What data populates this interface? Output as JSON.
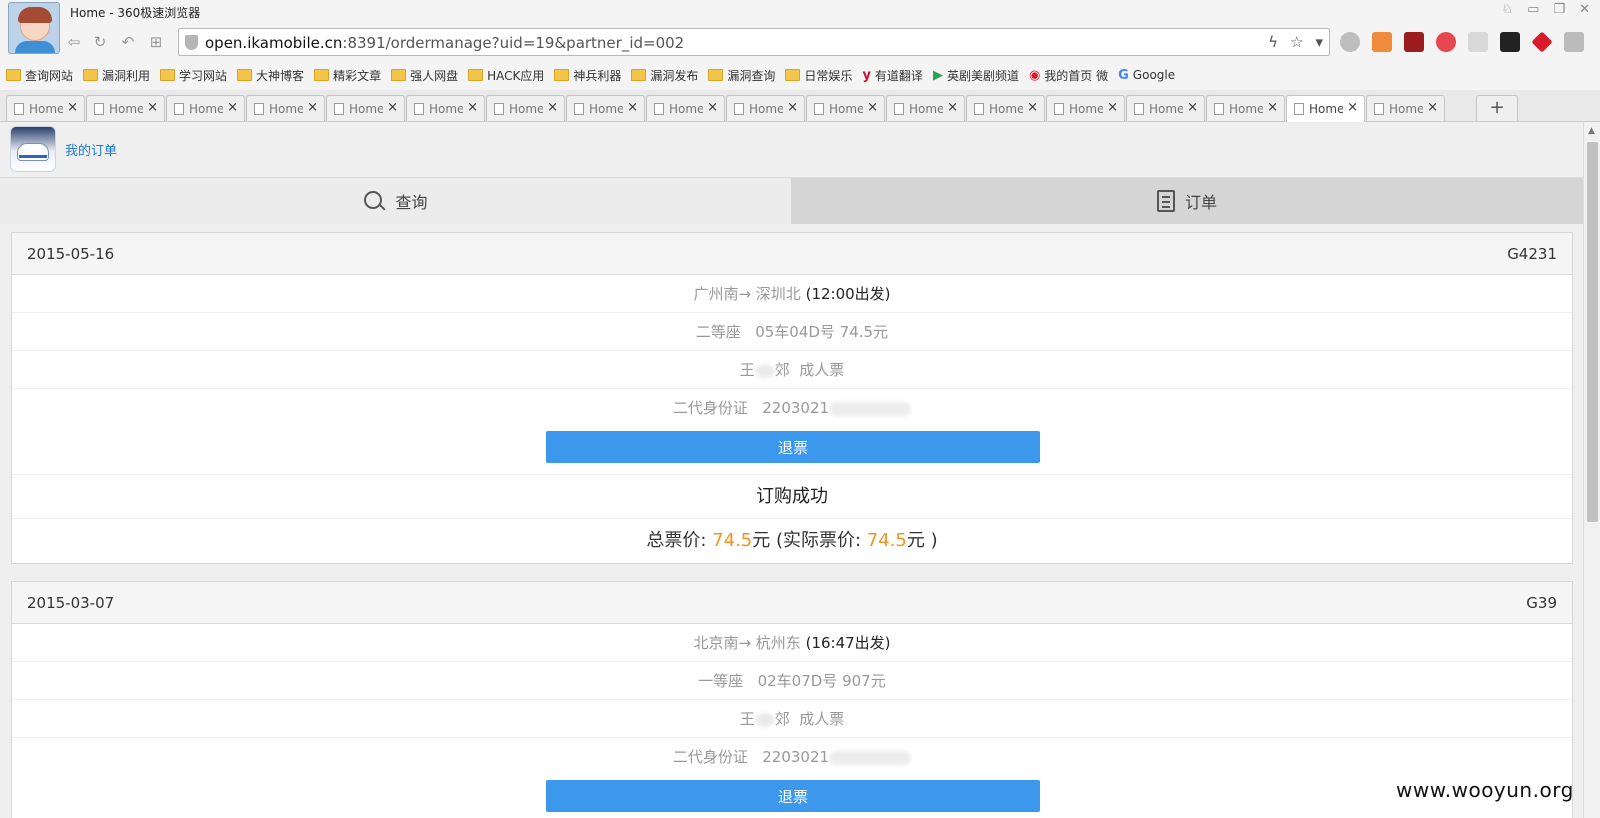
{
  "window": {
    "title": "Home - 360极速浏览器"
  },
  "address": {
    "host": "open.ikamobile.cn",
    "rest": ":8391/ordermanage?uid=19&partner_id=002"
  },
  "bookmarks": [
    {
      "label": "查询网站",
      "icon": "folder-icon"
    },
    {
      "label": "漏洞利用",
      "icon": "folder-icon"
    },
    {
      "label": "学习网站",
      "icon": "folder-icon"
    },
    {
      "label": "大神博客",
      "icon": "folder-icon"
    },
    {
      "label": "精彩文章",
      "icon": "folder-icon"
    },
    {
      "label": "强人网盘",
      "icon": "folder-icon"
    },
    {
      "label": "HACK应用",
      "icon": "folder-icon"
    },
    {
      "label": "神兵利器",
      "icon": "folder-icon"
    },
    {
      "label": "漏洞发布",
      "icon": "folder-icon"
    },
    {
      "label": "漏洞查询",
      "icon": "folder-icon"
    },
    {
      "label": "日常娱乐",
      "icon": "folder-icon"
    },
    {
      "label": "有道翻译",
      "icon": "youdao-icon"
    },
    {
      "label": "英剧美剧频道",
      "icon": "play-icon"
    },
    {
      "label": "我的首页 微",
      "icon": "weibo-icon"
    },
    {
      "label": "Google",
      "icon": "google-icon"
    }
  ],
  "tabs": {
    "label": "Home",
    "close": "×",
    "count": 18,
    "active_index": 16,
    "new_tab": "+"
  },
  "app": {
    "title": "我的订单",
    "nav": {
      "query": "查询",
      "orders": "订单"
    }
  },
  "orders": [
    {
      "date": "2015-05-16",
      "train": "G4231",
      "route": "广州南→ 深圳北",
      "depart": "(12:00出发)",
      "seat_class": "二等座",
      "seat": "05车04D号 74.5元",
      "passenger_a": "王",
      "passenger_b": "郊",
      "ticket_type": "成人票",
      "id_type": "二代身份证",
      "id_no": "2203021",
      "refund": "退票",
      "status": "订购成功",
      "total_label": "总票价: ",
      "total": "74.5",
      "unit": "元",
      "actual_label": " (实际票价: ",
      "actual": "74.5",
      "unit_close": "元 )"
    },
    {
      "date": "2015-03-07",
      "train": "G39",
      "route": "北京南→ 杭州东",
      "depart": "(16:47出发)",
      "seat_class": "一等座",
      "seat": "02车07D号 907元",
      "passenger_a": "王",
      "passenger_b": "郊",
      "ticket_type": "成人票",
      "id_type": "二代身份证",
      "id_no": "2203021",
      "refund": "退票"
    }
  ],
  "watermark": "www.wooyun.org"
}
